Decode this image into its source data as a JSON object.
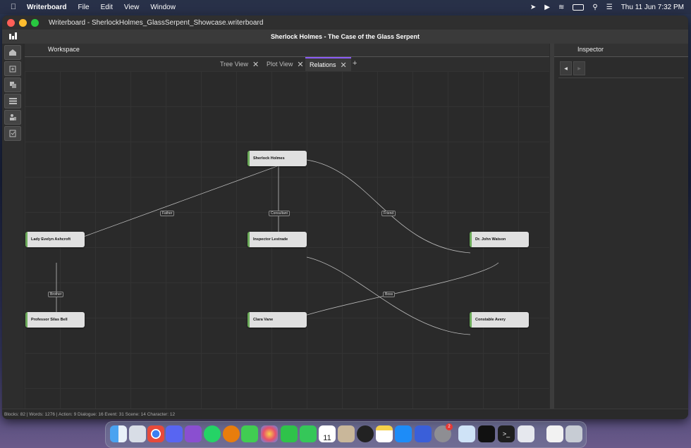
{
  "menubar": {
    "app_name": "Writerboard",
    "items": [
      "File",
      "Edit",
      "View",
      "Window"
    ],
    "datetime": "Thu 11 Jun  7:32 PM"
  },
  "window": {
    "title": "Writerboard - SherlockHolmes_GlassSerpent_Showcase.writerboard",
    "document_title": "Sherlock Holmes - The Case of the Glass Serpent"
  },
  "workspace": {
    "header": "Workspace",
    "tabs": [
      {
        "label": "Tree View"
      },
      {
        "label": "Plot View"
      },
      {
        "label": "Relations",
        "active": true
      }
    ],
    "add_tab": "+"
  },
  "graph": {
    "nodes": [
      {
        "id": "holmes",
        "label": "Sherlock Holmes"
      },
      {
        "id": "ashcroft",
        "label": "Lady Evelyn Ashcroft"
      },
      {
        "id": "lestrade",
        "label": "Inspector Lestrade"
      },
      {
        "id": "watson",
        "label": "Dr. John Watson"
      },
      {
        "id": "bell",
        "label": "Professor Silas Bell"
      },
      {
        "id": "vane",
        "label": "Clara Vane"
      },
      {
        "id": "avery",
        "label": "Constable Avery"
      }
    ],
    "edges": [
      {
        "from": "holmes",
        "to": "ashcroft",
        "label": "Father"
      },
      {
        "from": "holmes",
        "to": "lestrade",
        "label": "Consultant"
      },
      {
        "from": "holmes",
        "to": "watson",
        "label": "Friend"
      },
      {
        "from": "ashcroft",
        "to": "bell",
        "label": "Brother"
      },
      {
        "from": "lestrade",
        "to": "avery",
        "label": "Boss"
      },
      {
        "from": "watson",
        "to": "vane",
        "label": ""
      }
    ]
  },
  "inspector": {
    "header": "Inspector",
    "prev_glyph": "◀",
    "next_glyph": "▶"
  },
  "status_bar": "Blocks: 82  |  Words: 1276  |  Action: 9  Dialogue: 16  Event: 31  Scene: 14  Character: 12",
  "dock_apps": [
    "Finder",
    "Launchpad",
    "Chrome",
    "Discord",
    "GitHub Desktop",
    "WhatsApp",
    "Blender",
    "Qt Creator",
    "Photos",
    "FaceTime",
    "Phone",
    "Calendar",
    "Contacts",
    "OBS",
    "Notes",
    "App Store",
    "Simulator",
    "System Settings",
    "Docker",
    "Epic Games",
    "Terminal",
    "Preview",
    "Documents",
    "Trash"
  ],
  "calendar_badge": "11",
  "settings_badge": "2"
}
